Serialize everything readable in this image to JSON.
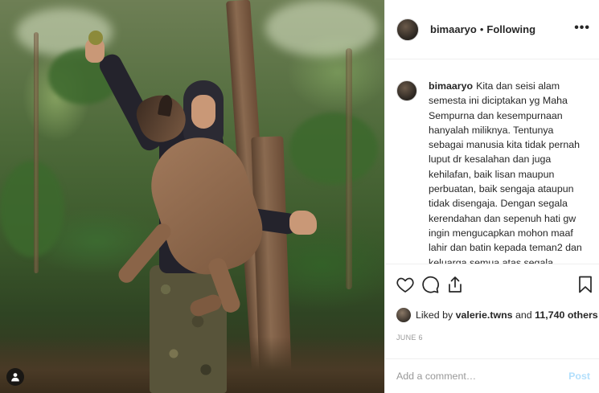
{
  "post": {
    "username": "bimaaryo",
    "separator": "•",
    "follow_status": "Following",
    "more_label": "•••"
  },
  "caption": {
    "username": "bimaaryo",
    "text": "Kita dan seisi alam semesta ini diciptakan yg Maha Sempurna dan kesempurnaan hanyalah miliknya. Tentunya sebagai manusia kita tidak pernah luput dr kesalahan dan juga kehilafan, baik lisan maupun perbuatan, baik sengaja ataupun tidak disengaja. Dengan segala kerendahan dan sepenuh hati gw ingin mengucapkan mohon maaf lahir dan batin kepada teman2 dan keluarga semua atas segala perbuatan atau"
  },
  "likes": {
    "prefix": "Liked by",
    "user": "valerie.twns",
    "connector": "and",
    "count": "11,740 others"
  },
  "date": "JUNE 6",
  "comment": {
    "placeholder": "Add a comment…",
    "post_label": "Post"
  },
  "icons": {
    "like": "heart-icon",
    "comment": "comment-icon",
    "share": "share-icon",
    "save": "bookmark-icon",
    "tag": "user-tag-icon"
  },
  "colors": {
    "text": "#262626",
    "muted": "#999999",
    "post_disabled": "#b2dffc",
    "divider": "#efefef"
  }
}
